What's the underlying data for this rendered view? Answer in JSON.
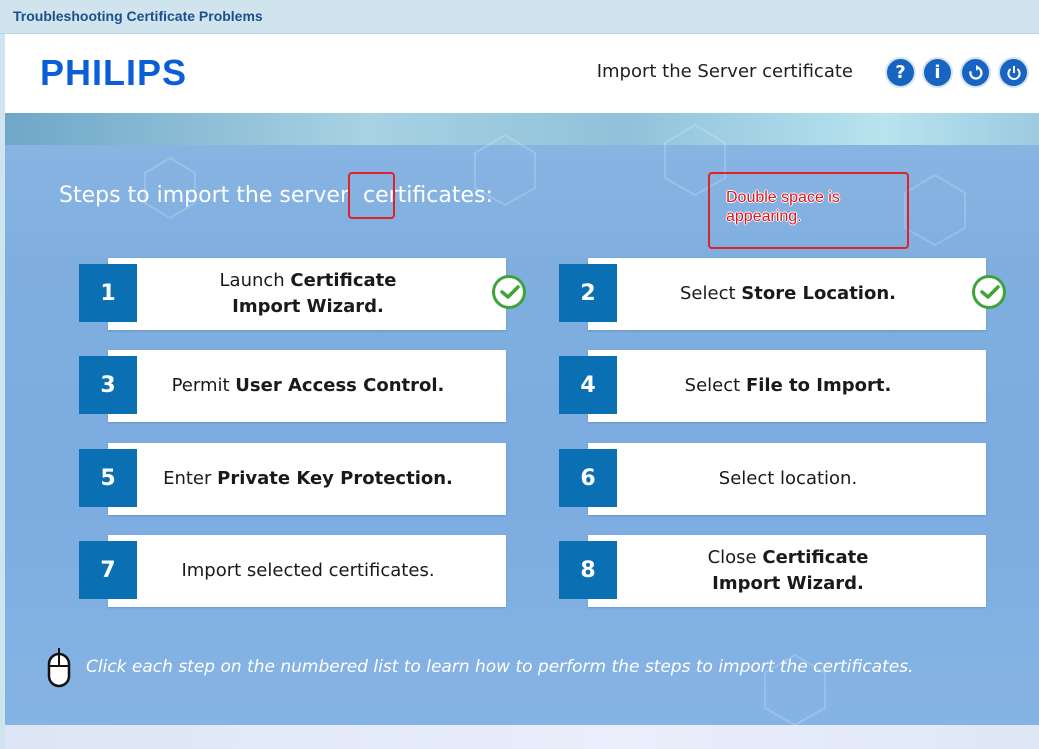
{
  "window": {
    "title": "Troubleshooting Certificate Problems"
  },
  "header": {
    "logo": "PHILIPS",
    "page_title": "Import the Server certificate",
    "buttons": [
      {
        "icon": "help-icon",
        "label": "?"
      },
      {
        "icon": "info-icon",
        "label": "i"
      },
      {
        "icon": "replay-icon",
        "label": ""
      },
      {
        "icon": "power-icon",
        "label": ""
      }
    ]
  },
  "main": {
    "heading": "Steps to import the server  certificates:",
    "annotation": "Double space is appearing.",
    "steps": [
      {
        "number": "1",
        "text_plain": "Launch ",
        "text_bold": "Certificate Import Wizard.",
        "completed": true
      },
      {
        "number": "2",
        "text_plain": "Select ",
        "text_bold": "Store Location.",
        "completed": true
      },
      {
        "number": "3",
        "text_plain": "Permit ",
        "text_bold": "User Access Control.",
        "completed": false
      },
      {
        "number": "4",
        "text_plain": "Select ",
        "text_bold": "File to Import.",
        "completed": false
      },
      {
        "number": "5",
        "text_plain": "Enter ",
        "text_bold": "Private Key Protection.",
        "completed": false
      },
      {
        "number": "6",
        "text_plain": "Select location.",
        "text_bold": "",
        "completed": false
      },
      {
        "number": "7",
        "text_plain": "Import selected certificates.",
        "text_bold": "",
        "completed": false
      },
      {
        "number": "8",
        "text_plain": "Close ",
        "text_bold": "Certificate Import Wizard.",
        "completed": false
      }
    ],
    "instruction": "Click each step on the numbered list to learn how to perform the steps to import the certificates."
  },
  "colors": {
    "accent": "#0b70b3",
    "logo": "#0b5ed7",
    "check": "#3ea43a",
    "annotation": "#e0202a"
  }
}
